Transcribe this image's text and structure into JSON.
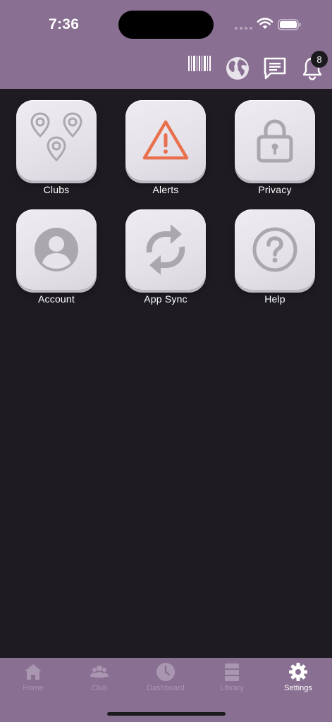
{
  "status_bar": {
    "time": "7:36"
  },
  "header": {
    "notification_count": "8"
  },
  "tiles": [
    {
      "label": "Clubs",
      "icon": "map-pins-icon"
    },
    {
      "label": "Alerts",
      "icon": "warning-icon"
    },
    {
      "label": "Privacy",
      "icon": "lock-icon"
    },
    {
      "label": "Account",
      "icon": "person-icon"
    },
    {
      "label": "App Sync",
      "icon": "sync-icon"
    },
    {
      "label": "Help",
      "icon": "question-icon"
    }
  ],
  "tabbar": {
    "items": [
      {
        "label": "Home",
        "icon": "house-icon"
      },
      {
        "label": "Club",
        "icon": "people-icon"
      },
      {
        "label": "Dashboard",
        "icon": "clock-icon"
      },
      {
        "label": "Library",
        "icon": "stack-icon"
      },
      {
        "label": "Settings",
        "icon": "gear-icon",
        "active": true
      }
    ]
  },
  "colors": {
    "header_bg": "#896f92",
    "body_bg": "#1e1c22",
    "tile_bg": "#e6e4ea",
    "icon_gray": "#aaa8ae",
    "alert_orange": "#e8704f",
    "tab_inactive": "#a996b0",
    "tab_active": "#ffffff"
  }
}
